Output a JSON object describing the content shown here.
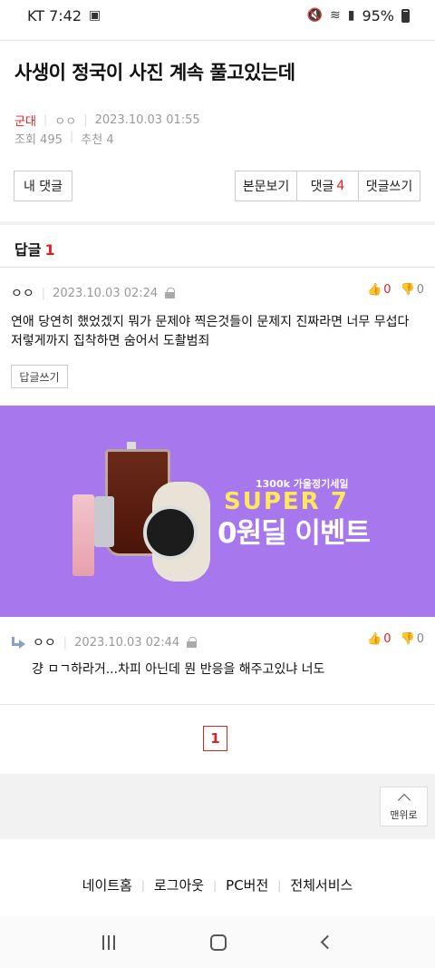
{
  "status": {
    "carrier_time": "KT 7:42",
    "battery": "95%"
  },
  "post": {
    "title": "사생이 정국이 사진 계속 풀고있는데",
    "board": "군대",
    "author": "ㅇㅇ",
    "datetime": "2023.10.03 01:55",
    "views": "조회 495",
    "recommend": "추천 4"
  },
  "buttons": {
    "my_comments": "내 댓글",
    "view_body": "본문보기",
    "comments_label": "댓글",
    "comments_count": "4",
    "write_comment": "댓글쓰기"
  },
  "replies": {
    "label": "답글",
    "count": "1"
  },
  "comments": [
    {
      "author": "ㅇㅇ",
      "datetime": "2023.10.03 02:24",
      "up": "0",
      "down": "0",
      "text": "연애 당연히 했었겠지 뭐가 문제야 찍은것들이 문제지 진짜라면 너무 무섭다 저렇게까지 집착하면 숨어서 도촬범죄",
      "reply_button": "답글쓰기"
    },
    {
      "author": "ㅇㅇ",
      "datetime": "2023.10.03 02:44",
      "up": "0",
      "down": "0",
      "text": "걍 ㅁㄱ하라거...차피 아닌데 뭔 반응을 해주고있냐 너도"
    }
  ],
  "ad": {
    "subtitle": "1300k  가을정기세일",
    "headline1": "SUPER 7",
    "headline2": "0원딜 이벤트",
    "bg_color": "#a777ee"
  },
  "pagination": {
    "current": "1"
  },
  "scroll_top": {
    "label": "맨위로"
  },
  "footer": {
    "links": [
      "네이트홈",
      "로그아웃",
      "PC버전",
      "전체서비스"
    ]
  },
  "accent_color": "#dd2222"
}
